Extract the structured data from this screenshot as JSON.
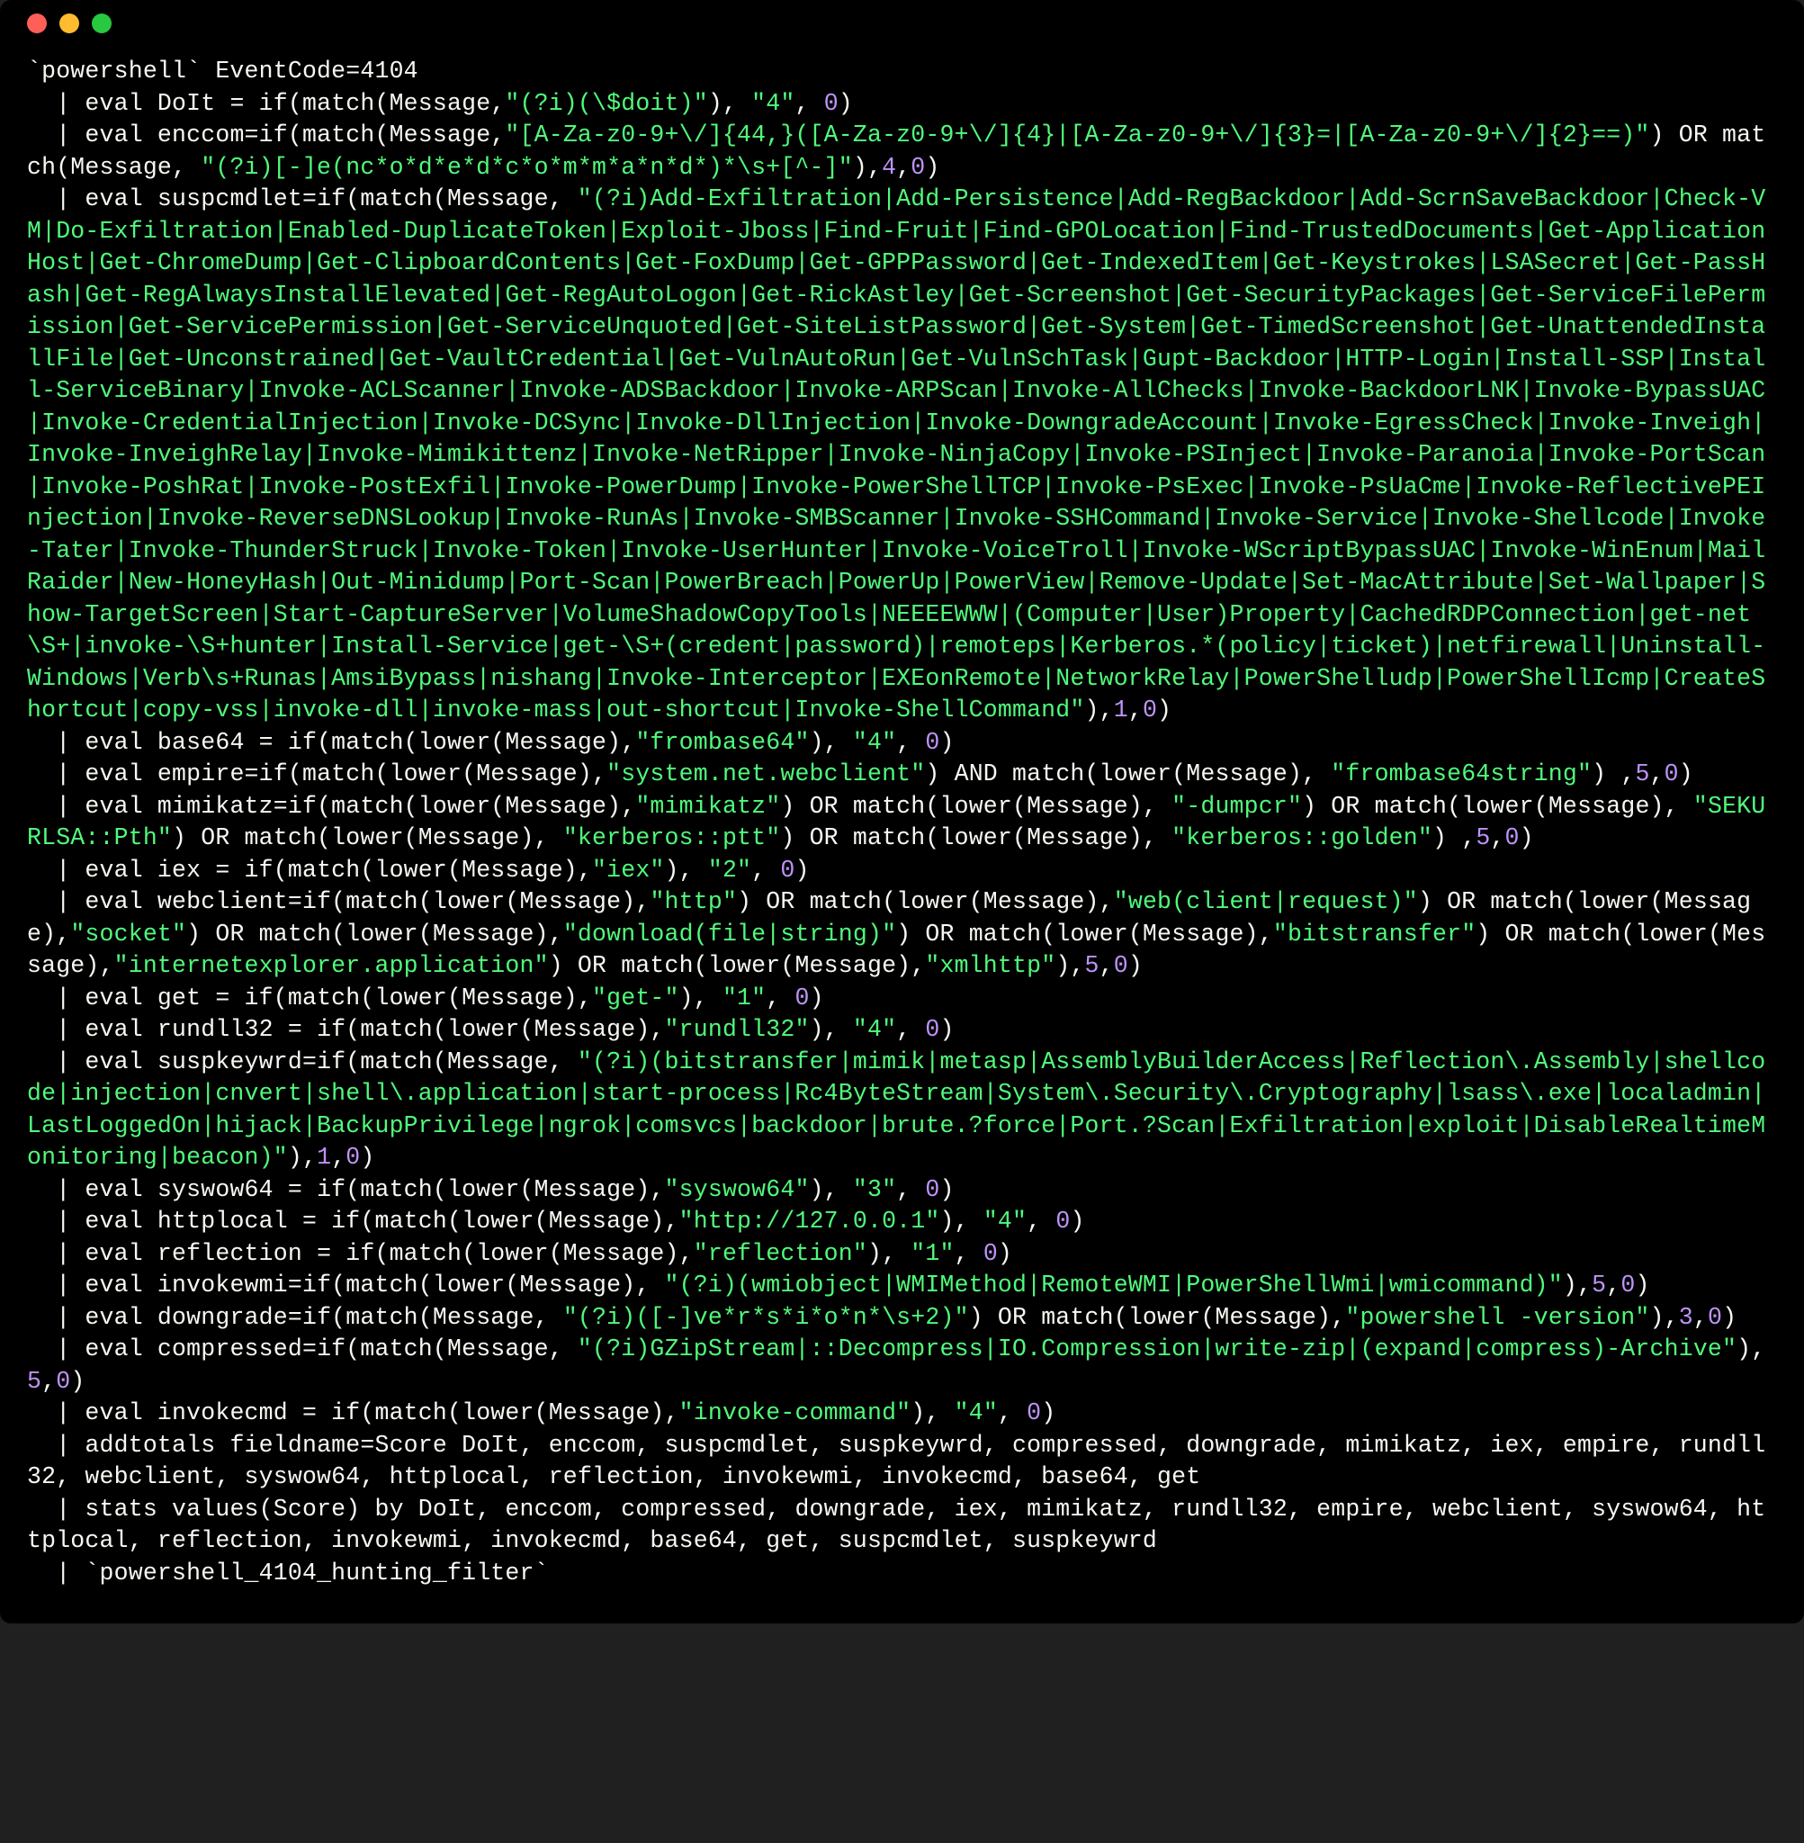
{
  "tokens": [
    {
      "c": "p",
      "t": "`powershell` EventCode=4104\n  | eval DoIt = if(match(Message,"
    },
    {
      "c": "s",
      "t": "\"(?i)(\\$doit)\""
    },
    {
      "c": "p",
      "t": "), "
    },
    {
      "c": "s",
      "t": "\"4\""
    },
    {
      "c": "p",
      "t": ", "
    },
    {
      "c": "n",
      "t": "0"
    },
    {
      "c": "p",
      "t": ")\n  | eval enccom=if(match(Message,"
    },
    {
      "c": "s",
      "t": "\"[A-Za-z0-9+\\/]{44,}([A-Za-z0-9+\\/]{4}|[A-Za-z0-9+\\/]{3}=|[A-Za-z0-9+\\/]{2}==)\""
    },
    {
      "c": "p",
      "t": ") OR match(Message, "
    },
    {
      "c": "s",
      "t": "\"(?i)[-]e(nc*o*d*e*d*c*o*m*m*a*n*d*)*\\s+[^-]\""
    },
    {
      "c": "p",
      "t": "),"
    },
    {
      "c": "n",
      "t": "4"
    },
    {
      "c": "p",
      "t": ","
    },
    {
      "c": "n",
      "t": "0"
    },
    {
      "c": "p",
      "t": ")\n  | eval suspcmdlet=if(match(Message, "
    },
    {
      "c": "s",
      "t": "\"(?i)Add-Exfiltration|Add-Persistence|Add-RegBackdoor|Add-ScrnSaveBackdoor|Check-VM|Do-Exfiltration|Enabled-DuplicateToken|Exploit-Jboss|Find-Fruit|Find-GPOLocation|Find-TrustedDocuments|Get-ApplicationHost|Get-ChromeDump|Get-ClipboardContents|Get-FoxDump|Get-GPPPassword|Get-IndexedItem|Get-Keystrokes|LSASecret|Get-PassHash|Get-RegAlwaysInstallElevated|Get-RegAutoLogon|Get-RickAstley|Get-Screenshot|Get-SecurityPackages|Get-ServiceFilePermission|Get-ServicePermission|Get-ServiceUnquoted|Get-SiteListPassword|Get-System|Get-TimedScreenshot|Get-UnattendedInstallFile|Get-Unconstrained|Get-VaultCredential|Get-VulnAutoRun|Get-VulnSchTask|Gupt-Backdoor|HTTP-Login|Install-SSP|Install-ServiceBinary|Invoke-ACLScanner|Invoke-ADSBackdoor|Invoke-ARPScan|Invoke-AllChecks|Invoke-BackdoorLNK|Invoke-BypassUAC|Invoke-CredentialInjection|Invoke-DCSync|Invoke-DllInjection|Invoke-DowngradeAccount|Invoke-EgressCheck|Invoke-Inveigh|Invoke-InveighRelay|Invoke-Mimikittenz|Invoke-NetRipper|Invoke-NinjaCopy|Invoke-PSInject|Invoke-Paranoia|Invoke-PortScan|Invoke-PoshRat|Invoke-PostExfil|Invoke-PowerDump|Invoke-PowerShellTCP|Invoke-PsExec|Invoke-PsUaCme|Invoke-ReflectivePEInjection|Invoke-ReverseDNSLookup|Invoke-RunAs|Invoke-SMBScanner|Invoke-SSHCommand|Invoke-Service|Invoke-Shellcode|Invoke-Tater|Invoke-ThunderStruck|Invoke-Token|Invoke-UserHunter|Invoke-VoiceTroll|Invoke-WScriptBypassUAC|Invoke-WinEnum|MailRaider|New-HoneyHash|Out-Minidump|Port-Scan|PowerBreach|PowerUp|PowerView|Remove-Update|Set-MacAttribute|Set-Wallpaper|Show-TargetScreen|Start-CaptureServer|VolumeShadowCopyTools|NEEEEWWW|(Computer|User)Property|CachedRDPConnection|get-net\\S+|invoke-\\S+hunter|Install-Service|get-\\S+(credent|password)|remoteps|Kerberos.*(policy|ticket)|netfirewall|Uninstall-Windows|Verb\\s+Runas|AmsiBypass|nishang|Invoke-Interceptor|EXEonRemote|NetworkRelay|PowerShelludp|PowerShellIcmp|CreateShortcut|copy-vss|invoke-dll|invoke-mass|out-shortcut|Invoke-ShellCommand\""
    },
    {
      "c": "p",
      "t": "),"
    },
    {
      "c": "n",
      "t": "1"
    },
    {
      "c": "p",
      "t": ","
    },
    {
      "c": "n",
      "t": "0"
    },
    {
      "c": "p",
      "t": ")\n  | eval base64 = if(match(lower(Message),"
    },
    {
      "c": "s",
      "t": "\"frombase64\""
    },
    {
      "c": "p",
      "t": "), "
    },
    {
      "c": "s",
      "t": "\"4\""
    },
    {
      "c": "p",
      "t": ", "
    },
    {
      "c": "n",
      "t": "0"
    },
    {
      "c": "p",
      "t": ")\n  | eval empire=if(match(lower(Message),"
    },
    {
      "c": "s",
      "t": "\"system.net.webclient\""
    },
    {
      "c": "p",
      "t": ") AND match(lower(Message), "
    },
    {
      "c": "s",
      "t": "\"frombase64string\""
    },
    {
      "c": "p",
      "t": ") ,"
    },
    {
      "c": "n",
      "t": "5"
    },
    {
      "c": "p",
      "t": ","
    },
    {
      "c": "n",
      "t": "0"
    },
    {
      "c": "p",
      "t": ")\n  | eval mimikatz=if(match(lower(Message),"
    },
    {
      "c": "s",
      "t": "\"mimikatz\""
    },
    {
      "c": "p",
      "t": ") OR match(lower(Message), "
    },
    {
      "c": "s",
      "t": "\"-dumpcr\""
    },
    {
      "c": "p",
      "t": ") OR match(lower(Message), "
    },
    {
      "c": "s",
      "t": "\"SEKURLSA::Pth\""
    },
    {
      "c": "p",
      "t": ") OR match(lower(Message), "
    },
    {
      "c": "s",
      "t": "\"kerberos::ptt\""
    },
    {
      "c": "p",
      "t": ") OR match(lower(Message), "
    },
    {
      "c": "s",
      "t": "\"kerberos::golden\""
    },
    {
      "c": "p",
      "t": ") ,"
    },
    {
      "c": "n",
      "t": "5"
    },
    {
      "c": "p",
      "t": ","
    },
    {
      "c": "n",
      "t": "0"
    },
    {
      "c": "p",
      "t": ")\n  | eval iex = if(match(lower(Message),"
    },
    {
      "c": "s",
      "t": "\"iex\""
    },
    {
      "c": "p",
      "t": "), "
    },
    {
      "c": "s",
      "t": "\"2\""
    },
    {
      "c": "p",
      "t": ", "
    },
    {
      "c": "n",
      "t": "0"
    },
    {
      "c": "p",
      "t": ")\n  | eval webclient=if(match(lower(Message),"
    },
    {
      "c": "s",
      "t": "\"http\""
    },
    {
      "c": "p",
      "t": ") OR match(lower(Message),"
    },
    {
      "c": "s",
      "t": "\"web(client|request)\""
    },
    {
      "c": "p",
      "t": ") OR match(lower(Message),"
    },
    {
      "c": "s",
      "t": "\"socket\""
    },
    {
      "c": "p",
      "t": ") OR match(lower(Message),"
    },
    {
      "c": "s",
      "t": "\"download(file|string)\""
    },
    {
      "c": "p",
      "t": ") OR match(lower(Message),"
    },
    {
      "c": "s",
      "t": "\"bitstransfer\""
    },
    {
      "c": "p",
      "t": ") OR match(lower(Message),"
    },
    {
      "c": "s",
      "t": "\"internetexplorer.application\""
    },
    {
      "c": "p",
      "t": ") OR match(lower(Message),"
    },
    {
      "c": "s",
      "t": "\"xmlhttp\""
    },
    {
      "c": "p",
      "t": "),"
    },
    {
      "c": "n",
      "t": "5"
    },
    {
      "c": "p",
      "t": ","
    },
    {
      "c": "n",
      "t": "0"
    },
    {
      "c": "p",
      "t": ")\n  | eval get = if(match(lower(Message),"
    },
    {
      "c": "s",
      "t": "\"get-\""
    },
    {
      "c": "p",
      "t": "), "
    },
    {
      "c": "s",
      "t": "\"1\""
    },
    {
      "c": "p",
      "t": ", "
    },
    {
      "c": "n",
      "t": "0"
    },
    {
      "c": "p",
      "t": ")\n  | eval rundll32 = if(match(lower(Message),"
    },
    {
      "c": "s",
      "t": "\"rundll32\""
    },
    {
      "c": "p",
      "t": "), "
    },
    {
      "c": "s",
      "t": "\"4\""
    },
    {
      "c": "p",
      "t": ", "
    },
    {
      "c": "n",
      "t": "0"
    },
    {
      "c": "p",
      "t": ")\n  | eval suspkeywrd=if(match(Message, "
    },
    {
      "c": "s",
      "t": "\"(?i)(bitstransfer|mimik|metasp|AssemblyBuilderAccess|Reflection\\.Assembly|shellcode|injection|cnvert|shell\\.application|start-process|Rc4ByteStream|System\\.Security\\.Cryptography|lsass\\.exe|localadmin|LastLoggedOn|hijack|BackupPrivilege|ngrok|comsvcs|backdoor|brute.?force|Port.?Scan|Exfiltration|exploit|DisableRealtimeMonitoring|beacon)\""
    },
    {
      "c": "p",
      "t": "),"
    },
    {
      "c": "n",
      "t": "1"
    },
    {
      "c": "p",
      "t": ","
    },
    {
      "c": "n",
      "t": "0"
    },
    {
      "c": "p",
      "t": ")\n  | eval syswow64 = if(match(lower(Message),"
    },
    {
      "c": "s",
      "t": "\"syswow64\""
    },
    {
      "c": "p",
      "t": "), "
    },
    {
      "c": "s",
      "t": "\"3\""
    },
    {
      "c": "p",
      "t": ", "
    },
    {
      "c": "n",
      "t": "0"
    },
    {
      "c": "p",
      "t": ")\n  | eval httplocal = if(match(lower(Message),"
    },
    {
      "c": "s",
      "t": "\"http://127.0.0.1\""
    },
    {
      "c": "p",
      "t": "), "
    },
    {
      "c": "s",
      "t": "\"4\""
    },
    {
      "c": "p",
      "t": ", "
    },
    {
      "c": "n",
      "t": "0"
    },
    {
      "c": "p",
      "t": ")\n  | eval reflection = if(match(lower(Message),"
    },
    {
      "c": "s",
      "t": "\"reflection\""
    },
    {
      "c": "p",
      "t": "), "
    },
    {
      "c": "s",
      "t": "\"1\""
    },
    {
      "c": "p",
      "t": ", "
    },
    {
      "c": "n",
      "t": "0"
    },
    {
      "c": "p",
      "t": ")\n  | eval invokewmi=if(match(lower(Message), "
    },
    {
      "c": "s",
      "t": "\"(?i)(wmiobject|WMIMethod|RemoteWMI|PowerShellWmi|wmicommand)\""
    },
    {
      "c": "p",
      "t": "),"
    },
    {
      "c": "n",
      "t": "5"
    },
    {
      "c": "p",
      "t": ","
    },
    {
      "c": "n",
      "t": "0"
    },
    {
      "c": "p",
      "t": ")\n  | eval downgrade=if(match(Message, "
    },
    {
      "c": "s",
      "t": "\"(?i)([-]ve*r*s*i*o*n*\\s+2)\""
    },
    {
      "c": "p",
      "t": ") OR match(lower(Message),"
    },
    {
      "c": "s",
      "t": "\"powershell -version\""
    },
    {
      "c": "p",
      "t": "),"
    },
    {
      "c": "n",
      "t": "3"
    },
    {
      "c": "p",
      "t": ","
    },
    {
      "c": "n",
      "t": "0"
    },
    {
      "c": "p",
      "t": ")\n  | eval compressed=if(match(Message, "
    },
    {
      "c": "s",
      "t": "\"(?i)GZipStream|::Decompress|IO.Compression|write-zip|(expand|compress)-Archive\""
    },
    {
      "c": "p",
      "t": "),"
    },
    {
      "c": "n",
      "t": "5"
    },
    {
      "c": "p",
      "t": ","
    },
    {
      "c": "n",
      "t": "0"
    },
    {
      "c": "p",
      "t": ")\n  | eval invokecmd = if(match(lower(Message),"
    },
    {
      "c": "s",
      "t": "\"invoke-command\""
    },
    {
      "c": "p",
      "t": "), "
    },
    {
      "c": "s",
      "t": "\"4\""
    },
    {
      "c": "p",
      "t": ", "
    },
    {
      "c": "n",
      "t": "0"
    },
    {
      "c": "p",
      "t": ")\n  | addtotals fieldname=Score DoIt, enccom, suspcmdlet, suspkeywrd, compressed, downgrade, mimikatz, iex, empire, rundll32, webclient, syswow64, httplocal, reflection, invokewmi, invokecmd, base64, get\n  | stats values(Score) by DoIt, enccom, compressed, downgrade, iex, mimikatz, rundll32, empire, webclient, syswow64, httplocal, reflection, invokewmi, invokecmd, base64, get, suspcmdlet, suspkeywrd\n  | `powershell_4104_hunting_filter`"
    }
  ]
}
